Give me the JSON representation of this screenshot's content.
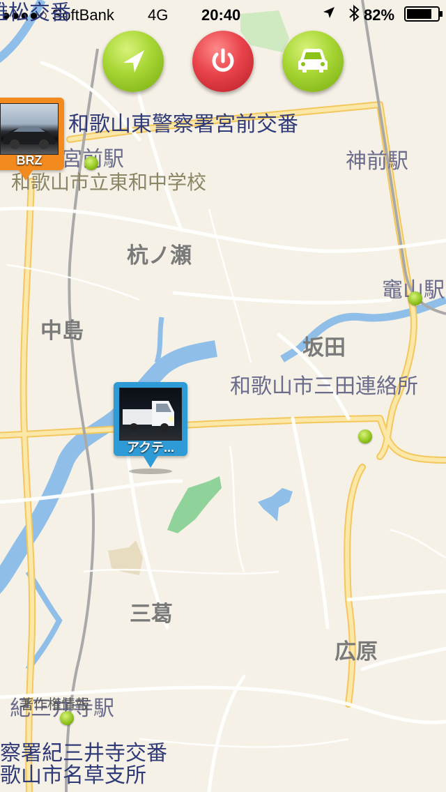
{
  "status_bar": {
    "carrier": "●●●●○ SoftBank",
    "network": "4G",
    "time": "20:40",
    "battery_percent": "82%",
    "battery_level": 0.82
  },
  "controls": {
    "locate_icon": "location-arrow-icon",
    "power_icon": "power-icon",
    "car_icon": "car-icon"
  },
  "map_labels": {
    "top_cut": "雄松交番",
    "police_box_east": "和歌山東警察署宮前交番",
    "miyamae_station": "宮前駅",
    "kanmae_station": "神前駅",
    "school": "和歌山市立東和中学校",
    "kuinose": "杭ノ瀬",
    "kamayama_station": "竈山駅",
    "nakajima": "中島",
    "sakata": "坂田",
    "mita_office": "和歌山市三田連絡所",
    "mikazura": "三葛",
    "hirohara": "広原",
    "kimiidera_station": "紀三井寺駅",
    "copyright_overlay": "著作権情報",
    "police_box_kimi": "察署紀三井寺交番",
    "nagusa_office": "歌山市名草支所"
  },
  "pins": {
    "brz": {
      "caption": "BRZ",
      "color": "#f28a1e"
    },
    "acty": {
      "caption": "アクテ...",
      "color": "#2e9ad6"
    }
  },
  "colors": {
    "map_background": "#f6f1e6",
    "road_yellow": "#f7d57a",
    "river": "#7fb6e8",
    "park": "#8fd39a"
  }
}
